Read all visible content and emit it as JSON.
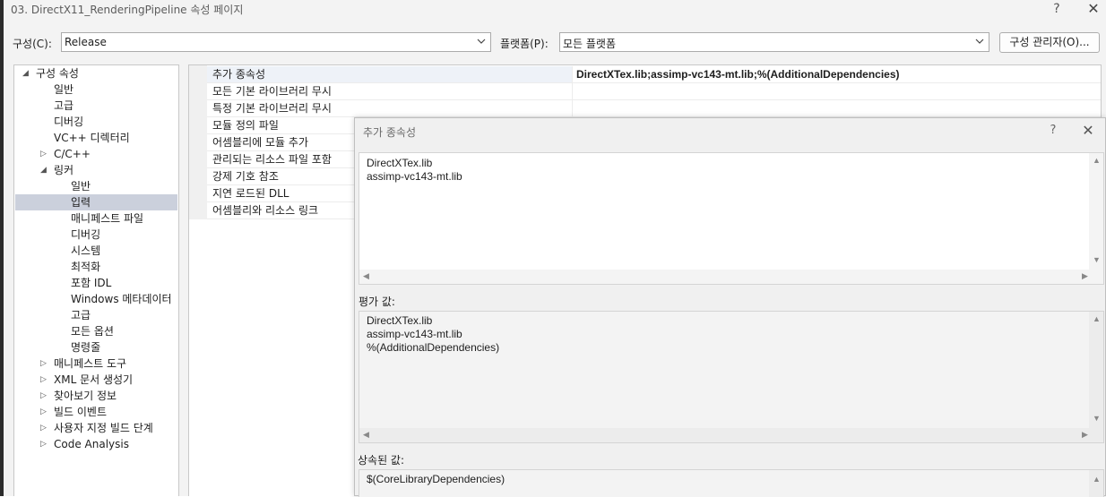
{
  "window": {
    "title": "03. DirectX11_RenderingPipeline 속성 페이지",
    "help": "?",
    "close": "✕"
  },
  "config_bar": {
    "config_label": "구성(C):",
    "config_value": "Release",
    "platform_label": "플랫폼(P):",
    "platform_value": "모든 플랫폼",
    "manager_button": "구성 관리자(O)..."
  },
  "tree": {
    "root": "구성 속성",
    "items": [
      "일반",
      "고급",
      "디버깅",
      "VC++ 디렉터리",
      "C/C++",
      "링커"
    ],
    "linker_items": [
      "일반",
      "입력",
      "매니페스트 파일",
      "디버깅",
      "시스템",
      "최적화",
      "포함 IDL",
      "Windows 메타데이터",
      "고급",
      "모든 옵션",
      "명령줄"
    ],
    "bottom_items": [
      "매니페스트 도구",
      "XML 문서 생성기",
      "찾아보기 정보",
      "빌드 이벤트",
      "사용자 지정 빌드 단계",
      "Code Analysis"
    ]
  },
  "properties": [
    {
      "name": "추가 종속성",
      "value": "DirectXTex.lib;assimp-vc143-mt.lib;%(AdditionalDependencies)"
    },
    {
      "name": "모든 기본 라이브러리 무시",
      "value": ""
    },
    {
      "name": "특정 기본 라이브러리 무시",
      "value": ""
    },
    {
      "name": "모듈 정의 파일",
      "value": ""
    },
    {
      "name": "어셈블리에 모듈 추가",
      "value": ""
    },
    {
      "name": "관리되는 리소스 파일 포함",
      "value": ""
    },
    {
      "name": "강제 기호 참조",
      "value": ""
    },
    {
      "name": "지연 로드된 DLL",
      "value": ""
    },
    {
      "name": "어셈블리와 리소스 링크",
      "value": ""
    }
  ],
  "dialog": {
    "title": "추가 종속성",
    "help": "?",
    "close": "✕",
    "edit_lines": [
      "DirectXTex.lib",
      "assimp-vc143-mt.lib"
    ],
    "evaluated_label": "평가 값:",
    "evaluated_lines": [
      "DirectXTex.lib",
      "assimp-vc143-mt.lib",
      "%(AdditionalDependencies)"
    ],
    "inherited_label": "상속된 값:",
    "inherited_lines": [
      "$(CoreLibraryDependencies)"
    ]
  },
  "icons": {
    "expand": "expand-triangle-icon",
    "collapse": "collapse-triangle-icon",
    "dropdown": "chevron-down-icon"
  }
}
